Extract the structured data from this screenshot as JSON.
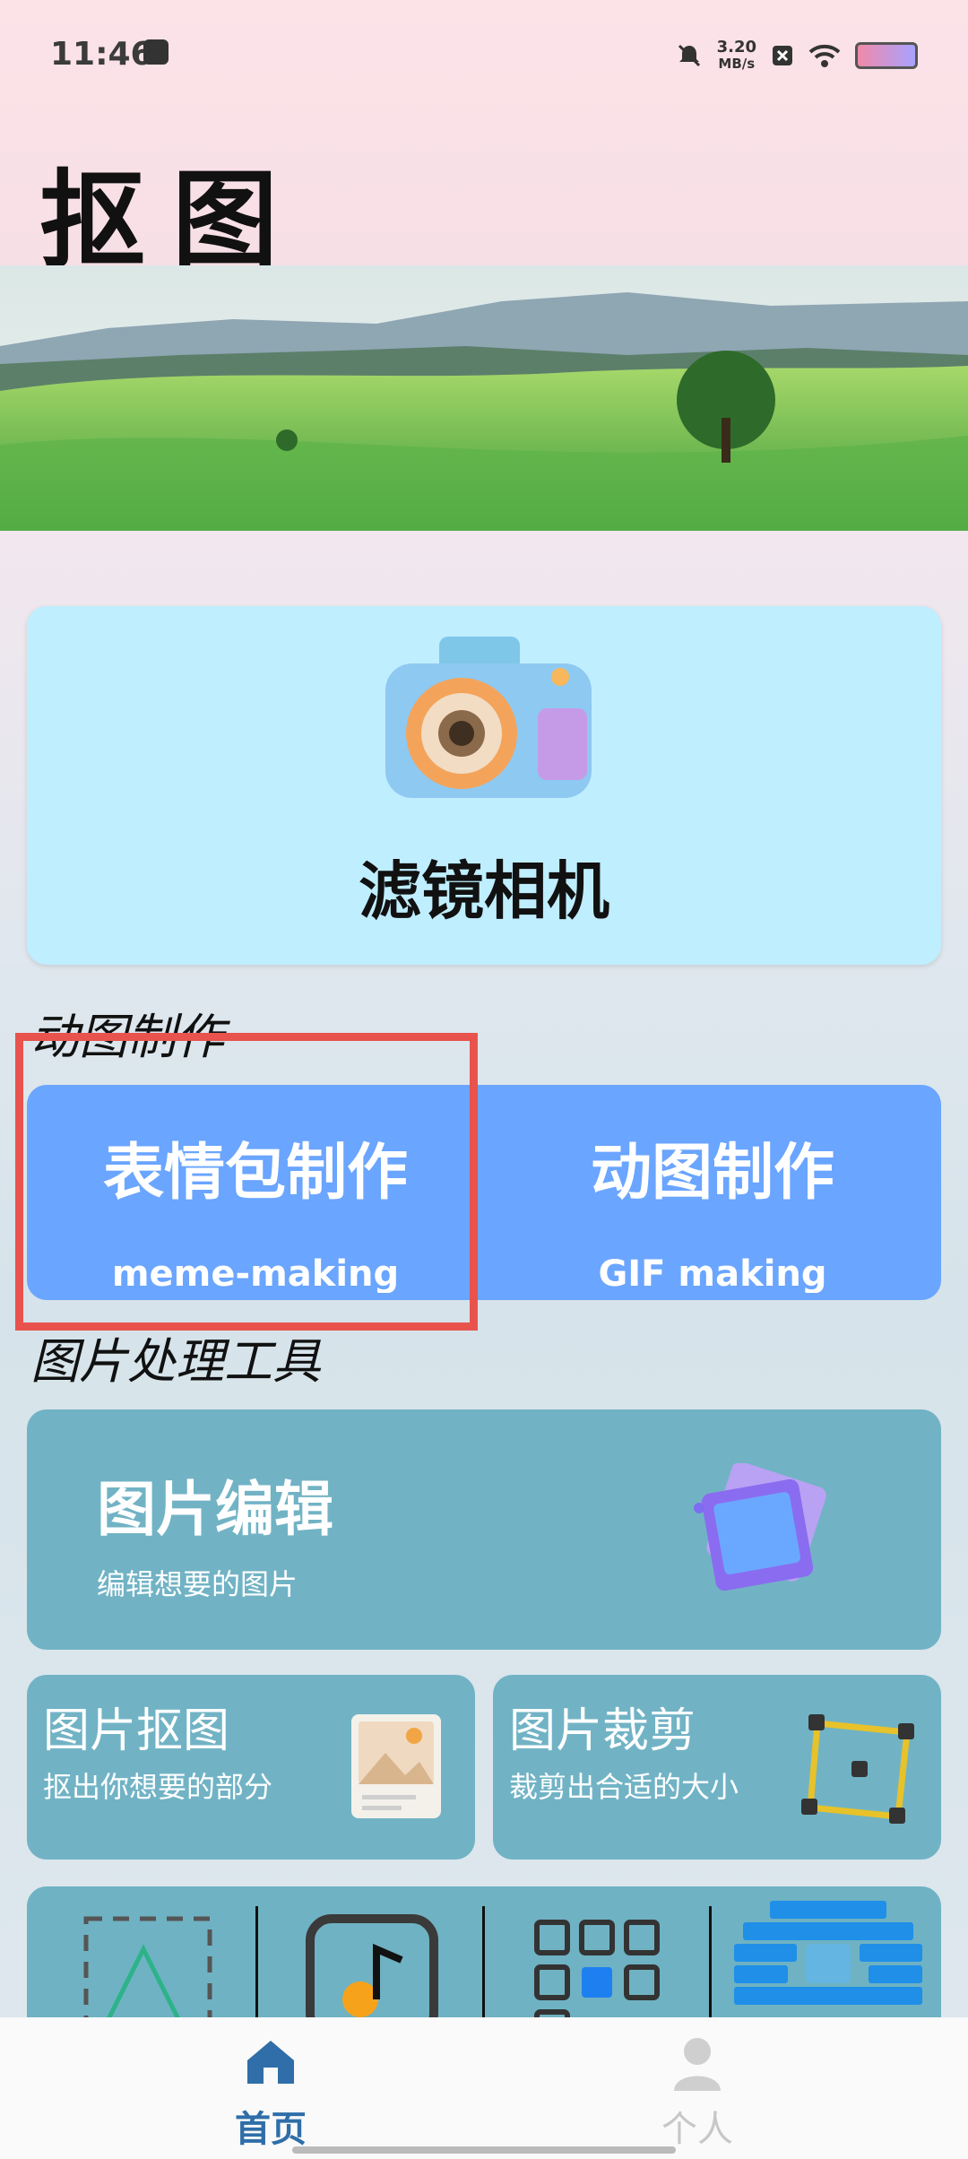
{
  "status_bar": {
    "time": "11:46",
    "speed_value": "3.20",
    "speed_unit": "MB/s"
  },
  "app": {
    "title": "抠图"
  },
  "filter_camera": {
    "label": "滤镜相机"
  },
  "sections": {
    "gif": "动图制作",
    "tools": "图片处理工具"
  },
  "gif_cards": [
    {
      "title": "表情包制作",
      "subtitle": "meme-making"
    },
    {
      "title": "动图制作",
      "subtitle": "GIF making"
    }
  ],
  "edit_card": {
    "title": "图片编辑",
    "subtitle": "编辑想要的图片"
  },
  "small_cards": [
    {
      "title": "图片抠图",
      "subtitle": "抠出你想要的部分"
    },
    {
      "title": "图片裁剪",
      "subtitle": "裁剪出合适的大小"
    }
  ],
  "tools": [
    "crop-select-icon",
    "music-note-icon",
    "grid-icon",
    "pixel-art-icon"
  ],
  "bottom_nav": {
    "home": "首页",
    "profile": "个人"
  },
  "colors": {
    "accent": "#2f6ea8",
    "gif_blue": "#6aa5ff",
    "teal_card": "#71b3c5",
    "camera_card": "#bfeeff",
    "highlight": "#e9534d"
  }
}
